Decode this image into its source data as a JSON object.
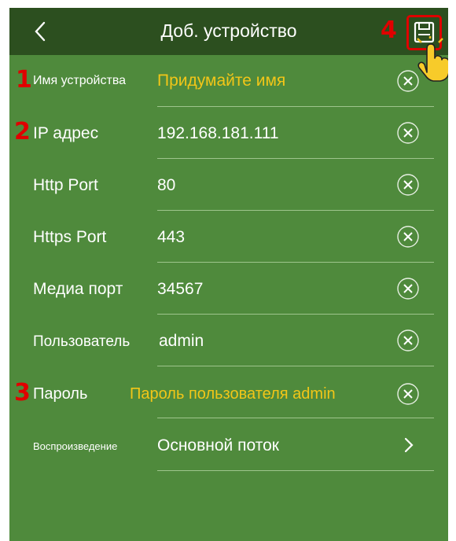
{
  "header": {
    "title": "Доб. устройство",
    "back_icon": "chevron-left-icon",
    "save_icon": "floppy-disk-icon"
  },
  "steps": {
    "s1": "1",
    "s2": "2",
    "s3": "3",
    "s4": "4"
  },
  "fields": {
    "name": {
      "label": "Имя устройства",
      "value": "Придумайте имя"
    },
    "ip": {
      "label": "IP адрес",
      "value": "192.168.181.111"
    },
    "http": {
      "label": "Http Port",
      "value": "80"
    },
    "https": {
      "label": "Https Port",
      "value": "443"
    },
    "media": {
      "label": "Медиа порт",
      "value": "34567"
    },
    "user": {
      "label": "Пользователь",
      "value": "admin"
    },
    "password": {
      "label": "Пароль",
      "value": "Пароль пользователя admin"
    },
    "playback": {
      "label": "Воспроизведение",
      "value": "Основной поток"
    }
  },
  "colors": {
    "header": "#2c4f1f",
    "background": "#4f8a3c",
    "hint_text": "#f2c618",
    "step_marker": "#e00000"
  }
}
